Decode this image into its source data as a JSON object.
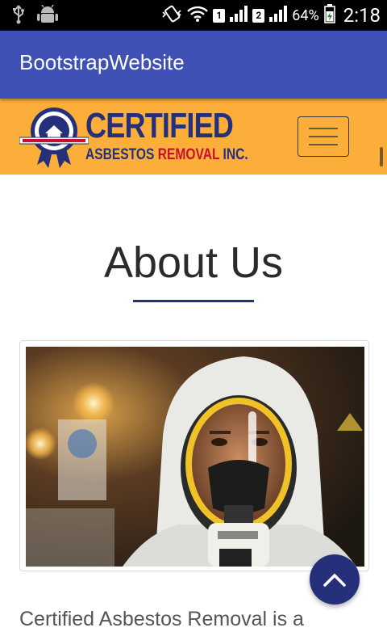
{
  "status_bar": {
    "sim1": "1",
    "sim2": "2",
    "battery_percent": "64%",
    "time": "2:18",
    "icons": [
      "usb-icon",
      "android-icon",
      "vibrate-icon",
      "wifi-icon",
      "signal-icon",
      "battery-icon"
    ]
  },
  "app_bar": {
    "title": "BootstrapWebsite"
  },
  "site_header": {
    "logo": {
      "word": "CERTIFIED",
      "sub_a": "ASBESTOS ",
      "sub_r": "REMOVAL ",
      "sub_i": "INC.",
      "badge_text": "CERTIFIED ASBESTOS REMOVAL INC",
      "ribbon_text": "SATISFACTION GUARANTEED"
    },
    "menu_icon": "hamburger-icon"
  },
  "main": {
    "heading": "About Us",
    "image_alt": "worker in protective suit and respirator mask",
    "paragraph_start": "Certified Asbestos Removal is a"
  },
  "fab": {
    "icon": "chevron-up-icon"
  },
  "colors": {
    "app_bar": "#3f51b5",
    "header": "#fbae3a",
    "brand_navy": "#26307a",
    "brand_red": "#c8102e"
  }
}
